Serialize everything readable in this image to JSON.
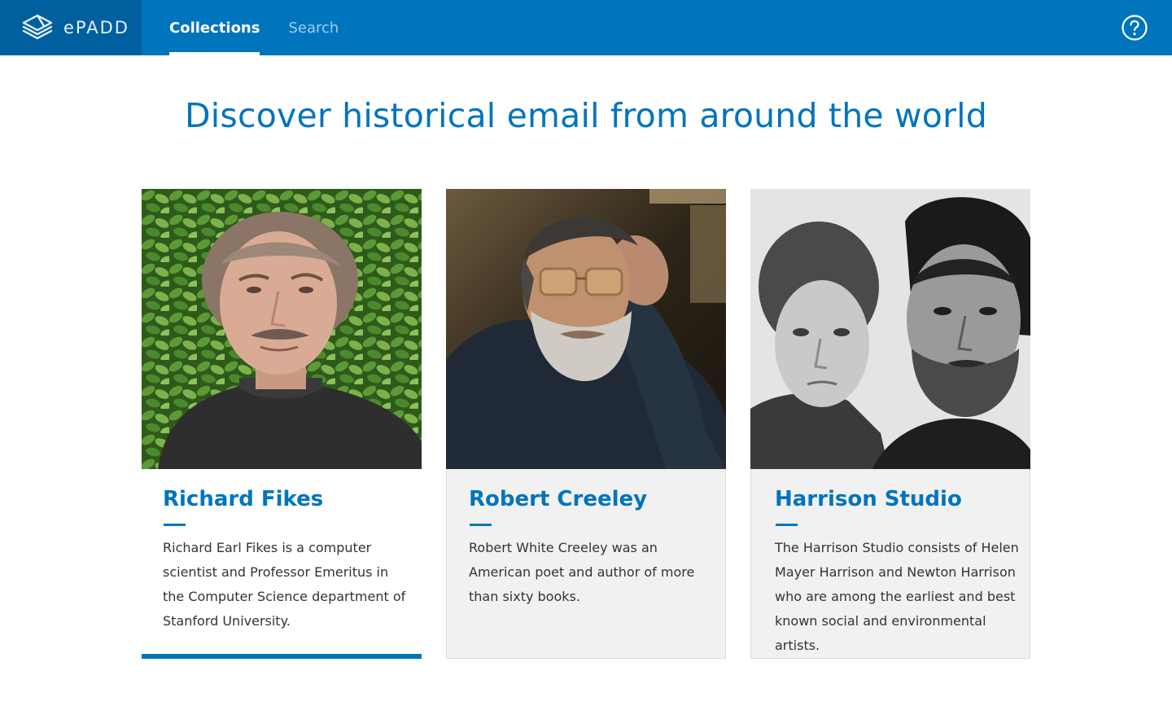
{
  "app": {
    "logo_text": "ePADD"
  },
  "nav": {
    "tabs": [
      {
        "label": "Collections",
        "active": true
      },
      {
        "label": "Search",
        "active": false
      }
    ],
    "help_icon": "help-circle-icon"
  },
  "main": {
    "headline": "Discover historical email from around the world",
    "collections": [
      {
        "name": "Richard Fikes",
        "description": "Richard Earl Fikes is a computer scientist and Professor Emeritus in the Computer Science department of Stanford University.",
        "photo": "portrait-photo"
      },
      {
        "name": "Robert Creeley",
        "description": "Robert White Creeley was an American poet and author of more than sixty books.",
        "photo": "portrait-photo"
      },
      {
        "name": "Harrison Studio",
        "description": "The Harrison Studio consists of Helen Mayer Harrison and Newton Harrison who are among the earliest and best known social and environmental artists.",
        "photo": "portrait-photo"
      }
    ]
  },
  "colors": {
    "brand_blue": "#0074bd",
    "logo_bg": "#00609f",
    "card_bg": "#f1f1f1"
  }
}
